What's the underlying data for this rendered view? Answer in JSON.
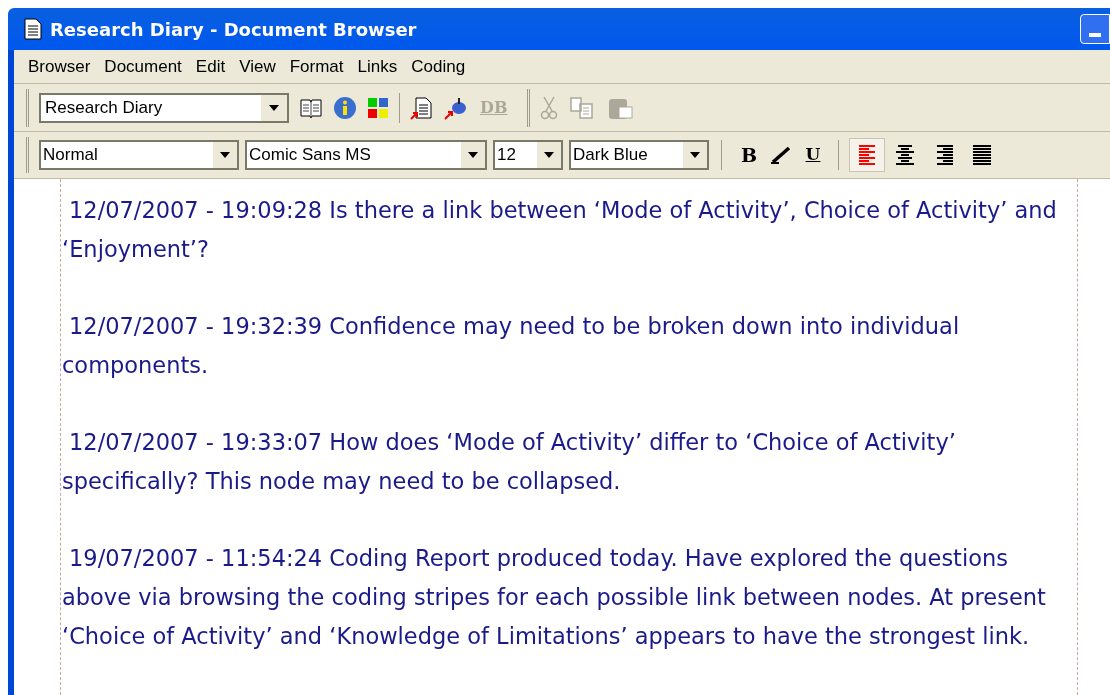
{
  "window": {
    "title": "Research Diary - Document Browser"
  },
  "menu": [
    "Browser",
    "Document",
    "Edit",
    "View",
    "Format",
    "Links",
    "Coding"
  ],
  "toolbar": {
    "document": "Research Diary",
    "db_button": {
      "label": "DB",
      "disabled": true
    },
    "clipboard_disabled": true
  },
  "format_bar": {
    "style": "Normal",
    "font": "Comic Sans MS",
    "size": "12",
    "text_color_name": "Dark Blue",
    "bold": "B",
    "underline": "U",
    "alignment": [
      {
        "kind": "left",
        "selected": true
      },
      {
        "kind": "center",
        "selected": false
      },
      {
        "kind": "right",
        "selected": false
      },
      {
        "kind": "justify",
        "selected": false
      }
    ]
  },
  "document": {
    "paragraphs": [
      "12/07/2007 - 19:09:28 Is there a link between ‘Mode of Activity’, Choice of Activity’ and ‘Enjoyment’?",
      "12/07/2007 - 19:32:39 Confidence may need to be broken down into individual components.",
      "12/07/2007 - 19:33:07 How does ‘Mode of Activity’ differ to ‘Choice of Activity’ specifically? This node may need to be collapsed.",
      "19/07/2007 - 11:54:24 Coding Report produced today. Have explored the questions above via browsing the coding stripes for each possible link between nodes. At present ‘Choice of Activity’ and ‘Knowledge of Limitations’ appears to have the strongest link."
    ]
  }
}
